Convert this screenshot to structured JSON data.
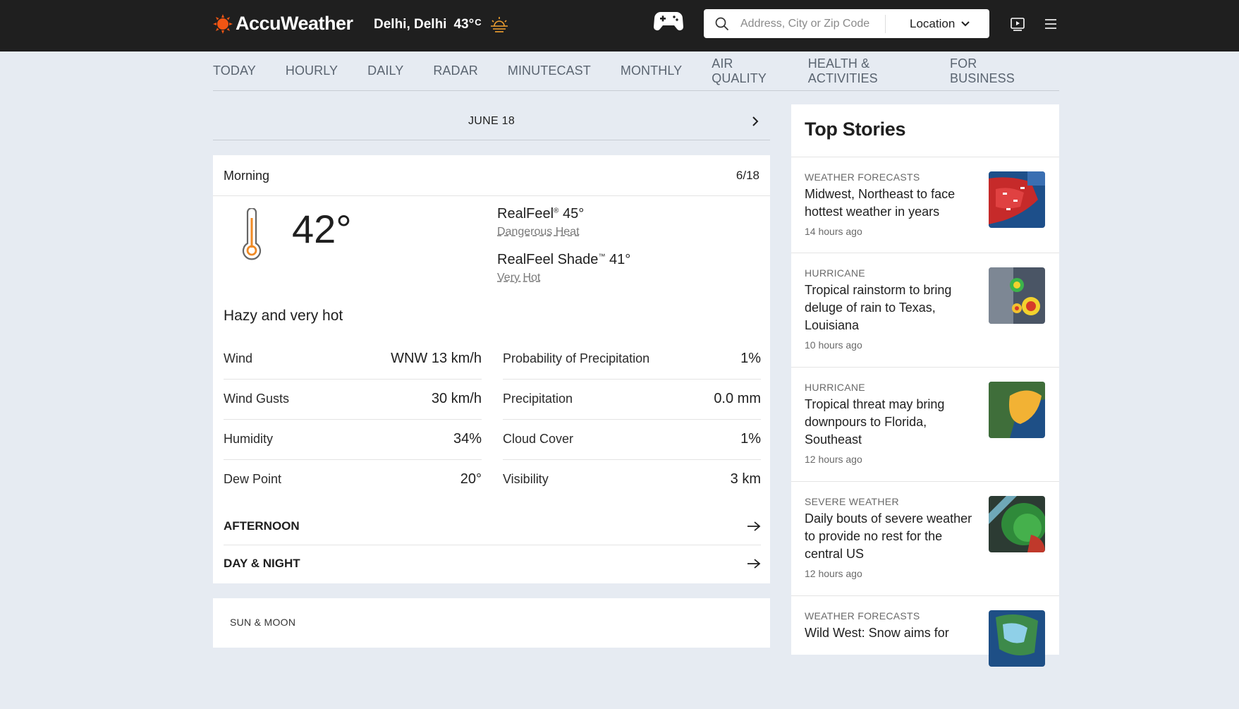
{
  "header": {
    "brand": "AccuWeather",
    "location": "Delhi, Delhi",
    "temp": "43°",
    "temp_unit": "C",
    "search_placeholder": "Address, City or Zip Code",
    "location_button": "Location",
    "colors": {
      "bar": "#1f1f1f",
      "brand_orange": "#f05514"
    }
  },
  "nav": {
    "items": [
      "TODAY",
      "HOURLY",
      "DAILY",
      "RADAR",
      "MINUTECAST",
      "MONTHLY",
      "AIR QUALITY",
      "HEALTH & ACTIVITIES",
      "FOR BUSINESS"
    ]
  },
  "datebar": {
    "date": "JUNE 18"
  },
  "forecast": {
    "period": "Morning",
    "date": "6/18",
    "temp": "42°",
    "realfeel": {
      "label": "RealFeel",
      "tm": "®",
      "value": "45°",
      "phrase": "Dangerous Heat"
    },
    "realfeel_shade": {
      "label": "RealFeel Shade",
      "tm": "™",
      "value": "41°",
      "phrase": "Very Hot"
    },
    "phrase": "Hazy and very hot",
    "details_left": [
      {
        "label": "Wind",
        "value": "WNW 13 km/h"
      },
      {
        "label": "Wind Gusts",
        "value": "30 km/h"
      },
      {
        "label": "Humidity",
        "value": "34%"
      },
      {
        "label": "Dew Point",
        "value": "20°"
      }
    ],
    "details_right": [
      {
        "label": "Probability of Precipitation",
        "value": "1%"
      },
      {
        "label": "Precipitation",
        "value": "0.0 mm"
      },
      {
        "label": "Cloud Cover",
        "value": "1%"
      },
      {
        "label": "Visibility",
        "value": "3 km"
      }
    ],
    "links": [
      "AFTERNOON",
      "DAY & NIGHT"
    ]
  },
  "sun_moon": {
    "title": "SUN & MOON"
  },
  "top_stories": {
    "title": "Top Stories",
    "items": [
      {
        "category": "WEATHER FORECASTS",
        "title": "Midwest, Northeast to face hottest weather in years",
        "time": "14 hours ago"
      },
      {
        "category": "HURRICANE",
        "title": "Tropical rainstorm to bring deluge of rain to Texas, Louisiana",
        "time": "10 hours ago"
      },
      {
        "category": "HURRICANE",
        "title": "Tropical threat may bring downpours to Florida, Southeast",
        "time": "12 hours ago"
      },
      {
        "category": "SEVERE WEATHER",
        "title": "Daily bouts of severe weather to provide no rest for the central US",
        "time": "12 hours ago"
      },
      {
        "category": "WEATHER FORECASTS",
        "title": "Wild West: Snow aims for",
        "time": ""
      }
    ]
  }
}
